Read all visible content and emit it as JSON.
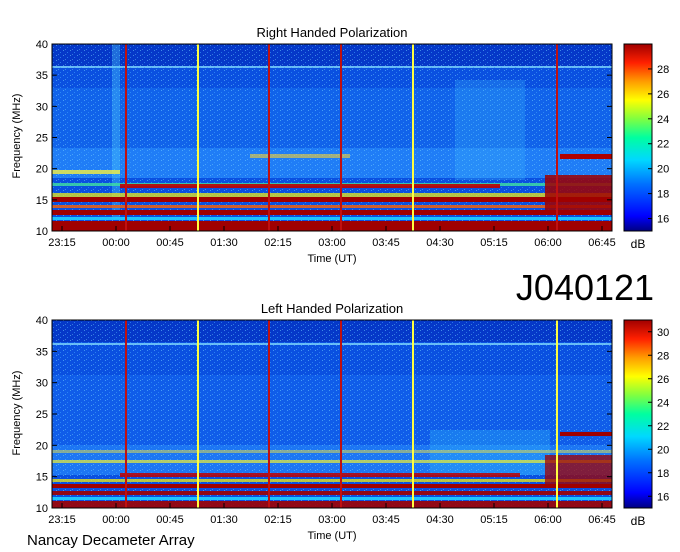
{
  "figure": {
    "label": "J040121",
    "footer": "Nancay Decameter Array"
  },
  "colors": {
    "colormap": [
      "#000082",
      "#0000ff",
      "#0070ff",
      "#00d8ff",
      "#00ffa0",
      "#80ff40",
      "#ffff00",
      "#ff9c00",
      "#ff2000",
      "#a00000"
    ],
    "marker_yellow": "#ffff40",
    "marker_red": "#c01010"
  },
  "chart_data": [
    {
      "type": "heatmap",
      "title": "Right Handed Polarization",
      "xlabel": "Time (UT)",
      "ylabel": "Frequency (MHz)",
      "x_tick_labels": [
        "23:15",
        "00:00",
        "00:45",
        "01:30",
        "02:15",
        "03:00",
        "03:45",
        "04:30",
        "05:15",
        "06:00",
        "06:45"
      ],
      "y_ticks": [
        10,
        15,
        20,
        25,
        30,
        35,
        40
      ],
      "ylim": [
        10,
        40
      ],
      "colorbar": {
        "label": "dB",
        "ticks": [
          16,
          18,
          20,
          22,
          24,
          26,
          28
        ],
        "range": [
          15,
          30
        ]
      },
      "time_markers": [
        {
          "time": "00:05",
          "color": "red"
        },
        {
          "time": "01:15",
          "color": "yellow"
        },
        {
          "time": "02:15",
          "color": "red"
        },
        {
          "time": "03:05",
          "color": "red"
        },
        {
          "time": "04:10",
          "color": "yellow"
        },
        {
          "time": "06:00",
          "color": "red"
        }
      ],
      "emission_bands_mhz": [
        11.5,
        13.5,
        15.5,
        17.0,
        19.0,
        21.5
      ]
    },
    {
      "type": "heatmap",
      "title": "Left Handed Polarization",
      "xlabel": "Time (UT)",
      "ylabel": "Frequency (MHz)",
      "x_tick_labels": [
        "23:15",
        "00:00",
        "00:45",
        "01:30",
        "02:15",
        "03:00",
        "03:45",
        "04:30",
        "05:15",
        "06:00",
        "06:45"
      ],
      "y_ticks": [
        10,
        15,
        20,
        25,
        30,
        35,
        40
      ],
      "ylim": [
        10,
        40
      ],
      "colorbar": {
        "label": "dB",
        "ticks": [
          16,
          18,
          20,
          22,
          24,
          26,
          28,
          30
        ],
        "range": [
          15,
          31
        ]
      },
      "time_markers": [
        {
          "time": "00:05",
          "color": "red"
        },
        {
          "time": "01:15",
          "color": "yellow"
        },
        {
          "time": "02:15",
          "color": "red"
        },
        {
          "time": "03:05",
          "color": "red"
        },
        {
          "time": "04:10",
          "color": "yellow"
        },
        {
          "time": "06:00",
          "color": "yellow"
        }
      ],
      "emission_bands_mhz": [
        11.0,
        12.5,
        14.0,
        15.5,
        17.5,
        21.5
      ]
    }
  ]
}
